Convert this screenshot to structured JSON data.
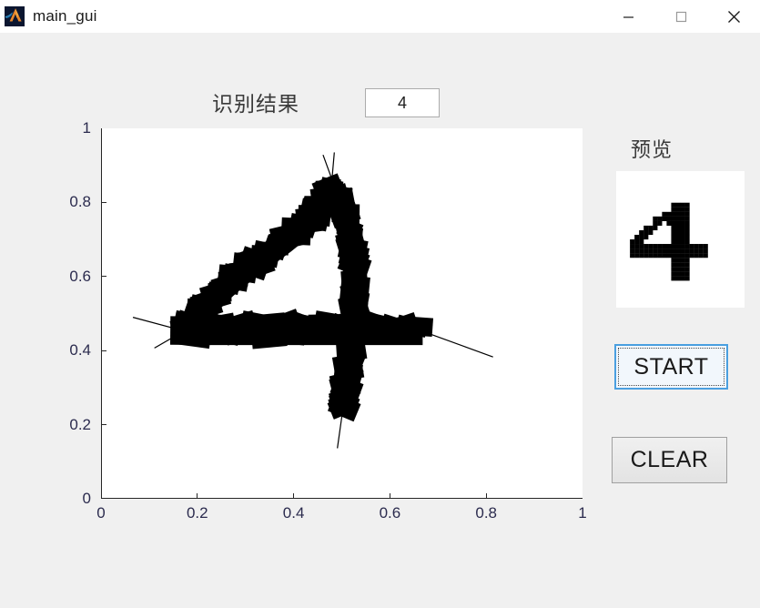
{
  "window": {
    "title": "main_gui",
    "icon": "matlab-logo-icon",
    "controls": {
      "minimize": "minimize-icon",
      "maximize": "maximize-icon",
      "close": "close-icon"
    },
    "background_color": "#f0f0f0",
    "titlebar_color": "#ffffff"
  },
  "header": {
    "result_label": "识别结果",
    "result_value": "4"
  },
  "preview": {
    "label": "预览",
    "digit": "4",
    "background_color": "#ffffff",
    "ink_color": "#000000",
    "grid": [
      "0000000000000000000000000000",
      "0000000000000000000000000000",
      "0000000000000000000000000000",
      "0000000000000000000000000000",
      "0000000000000000000000000000",
      "0000000000000000000000000000",
      "0000000000001111000000000000",
      "0000000000001111000000000000",
      "0000000000111111000000000000",
      "0000000011111111000000000000",
      "0000000011011111000000000000",
      "0000001110001111000000000000",
      "0000011100001111000000000000",
      "0000111000001111000000000000",
      "0001110000001111000000000000",
      "0001111111111111111100000000",
      "0001111111111111111100000000",
      "0001111111111111111100000000",
      "0000000000001111000000000000",
      "0000000000001111000000000000",
      "0000000000001111000000000000",
      "0000000000001111000000000000",
      "0000000000001111000000000000",
      "0000000000000000000000000000",
      "0000000000000000000000000000",
      "0000000000000000000000000000",
      "0000000000000000000000000000",
      "0000000000000000000000000000"
    ]
  },
  "buttons": {
    "start": "START",
    "clear": "CLEAR",
    "start_focus_color": "#4a9fe0"
  },
  "chart_data": {
    "type": "scatter",
    "title": "",
    "xlabel": "",
    "ylabel": "",
    "xlim": [
      0,
      1
    ],
    "ylim": [
      0,
      1
    ],
    "grid": false,
    "legend": null,
    "xticks": [
      "0",
      "0.2",
      "0.4",
      "0.6",
      "0.8",
      "1"
    ],
    "xtick_values": [
      0,
      0.2,
      0.4,
      0.6,
      0.8,
      1
    ],
    "yticks": [
      "0",
      "0.2",
      "0.4",
      "0.6",
      "0.8",
      "1"
    ],
    "ytick_values": [
      0,
      0.2,
      0.4,
      0.6,
      0.8,
      1
    ],
    "plot_background": "#ffffff",
    "ink_color": "#000000",
    "description": "Hand-drawn digit 4 rendered as thick black brush strokes on a unit-square axes",
    "strokes": [
      {
        "name": "diagonal-stroke",
        "points": [
          [
            0.175,
            0.455
          ],
          [
            0.19,
            0.47
          ],
          [
            0.205,
            0.495
          ],
          [
            0.22,
            0.52
          ],
          [
            0.238,
            0.545
          ],
          [
            0.258,
            0.57
          ],
          [
            0.28,
            0.595
          ],
          [
            0.305,
            0.62
          ],
          [
            0.33,
            0.645
          ],
          [
            0.355,
            0.668
          ],
          [
            0.38,
            0.692
          ],
          [
            0.405,
            0.718
          ],
          [
            0.428,
            0.745
          ],
          [
            0.448,
            0.772
          ],
          [
            0.462,
            0.8
          ],
          [
            0.472,
            0.822
          ],
          [
            0.478,
            0.838
          ]
        ],
        "width": 0.052
      },
      {
        "name": "vertical-stroke",
        "points": [
          [
            0.492,
            0.818
          ],
          [
            0.5,
            0.79
          ],
          [
            0.508,
            0.758
          ],
          [
            0.515,
            0.722
          ],
          [
            0.52,
            0.685
          ],
          [
            0.524,
            0.648
          ],
          [
            0.526,
            0.61
          ],
          [
            0.527,
            0.572
          ],
          [
            0.527,
            0.535
          ],
          [
            0.526,
            0.498
          ],
          [
            0.524,
            0.462
          ],
          [
            0.521,
            0.425
          ],
          [
            0.518,
            0.388
          ],
          [
            0.514,
            0.35
          ],
          [
            0.51,
            0.312
          ],
          [
            0.506,
            0.278
          ],
          [
            0.503,
            0.25
          ],
          [
            0.501,
            0.23
          ]
        ],
        "width": 0.05
      },
      {
        "name": "horizontal-stroke",
        "points": [
          [
            0.175,
            0.452
          ],
          [
            0.215,
            0.452
          ],
          [
            0.258,
            0.452
          ],
          [
            0.302,
            0.452
          ],
          [
            0.348,
            0.452
          ],
          [
            0.395,
            0.452
          ],
          [
            0.442,
            0.452
          ],
          [
            0.49,
            0.452
          ],
          [
            0.538,
            0.452
          ],
          [
            0.585,
            0.452
          ],
          [
            0.63,
            0.452
          ],
          [
            0.668,
            0.452
          ]
        ],
        "width": 0.062
      }
    ]
  }
}
